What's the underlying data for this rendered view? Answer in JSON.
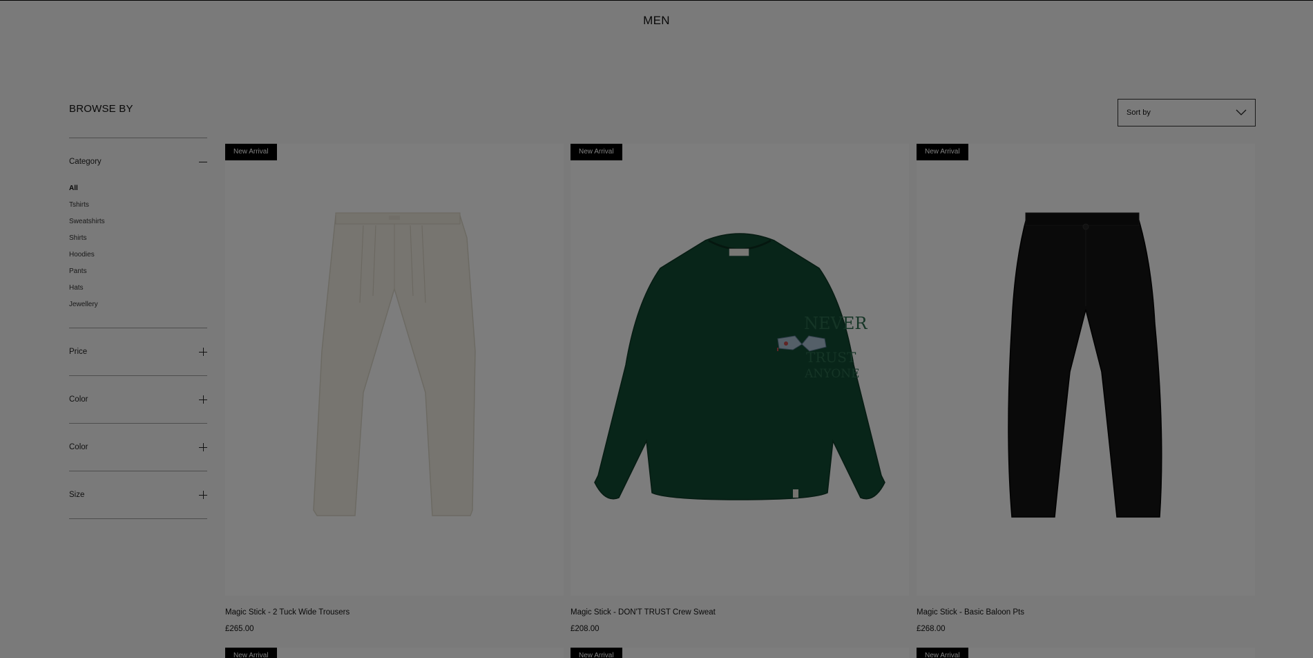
{
  "page": {
    "title": "MEN"
  },
  "browse": {
    "title": "BROWSE BY"
  },
  "filters": {
    "category": {
      "label": "Category",
      "items": [
        "All",
        "Tshirts",
        "Sweatshirts",
        "Shirts",
        "Hoodies",
        "Pants",
        "Hats",
        "Jewellery"
      ],
      "active": "All"
    },
    "price": {
      "label": "Price"
    },
    "color1": {
      "label": "Color"
    },
    "color2": {
      "label": "Color"
    },
    "size": {
      "label": "Size"
    }
  },
  "sort": {
    "label": "Sort by"
  },
  "products": [
    {
      "badge": "New Arrival",
      "name": "Magic Stick - 2 Tuck Wide Trousers",
      "price": "£265.00",
      "image": "cream-trousers"
    },
    {
      "badge": "New Arrival",
      "name": "Magic Stick - DON'T TRUST Crew Sweat",
      "price": "£208.00",
      "image": "green-sweatshirt"
    },
    {
      "badge": "New Arrival",
      "name": "Magic Stick - Basic Baloon Pts",
      "price": "£268.00",
      "image": "black-balloon-pants"
    }
  ],
  "next_row_badges": [
    "New Arrival",
    "New Arrival",
    "New Arrival"
  ],
  "sweat_print": {
    "line1": "NEVER",
    "line2": "TRUST",
    "line3": "ANYONE"
  },
  "colors": {
    "overlay": "#000000",
    "cream": "#efebe0",
    "green": "#114a32",
    "black": "#151515"
  }
}
